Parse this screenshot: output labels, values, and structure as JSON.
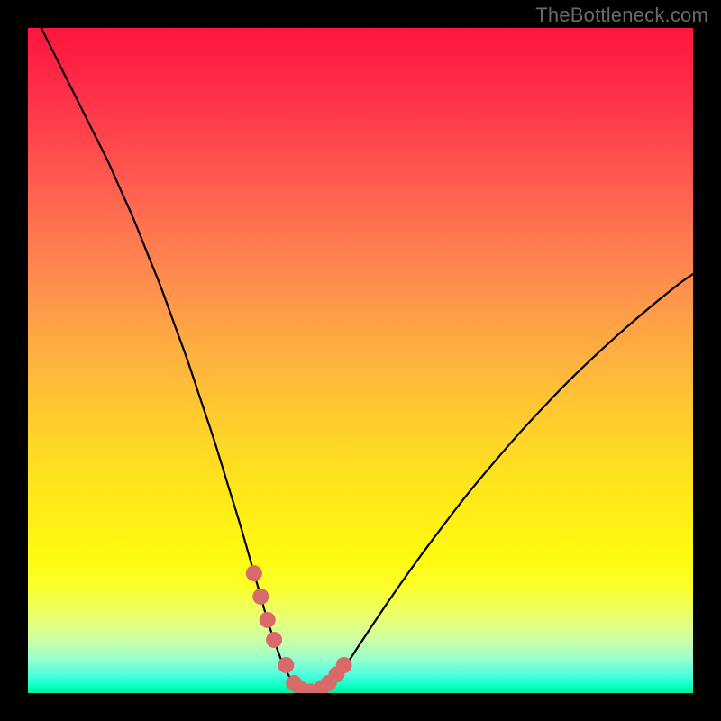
{
  "watermark": {
    "text": "TheBottleneck.com"
  },
  "colors": {
    "page_bg": "#000000",
    "curve": "#000000",
    "marker_fill": "#d86a6a",
    "marker_stroke": "#d86a6a",
    "gradient_top": "#ff163e",
    "gradient_bottom": "#02f09a"
  },
  "chart_data": {
    "type": "line",
    "title": "",
    "xlabel": "",
    "ylabel": "",
    "xlim": [
      0,
      100
    ],
    "ylim": [
      0,
      100
    ],
    "grid": false,
    "legend": false,
    "series": [
      {
        "name": "bottleneck-curve",
        "x": [
          2,
          4,
          6,
          8,
          10,
          12,
          14,
          16,
          18,
          20,
          22,
          24,
          26,
          28,
          30,
          32,
          34,
          35,
          36,
          37,
          38,
          39,
          40,
          41,
          42,
          43,
          44,
          46,
          48,
          50,
          54,
          58,
          62,
          66,
          70,
          74,
          78,
          82,
          86,
          90,
          94,
          98,
          100
        ],
        "values": [
          100,
          96,
          92,
          88,
          84,
          80,
          75.5,
          71,
          66,
          61,
          55.5,
          50,
          44,
          38,
          31.5,
          25,
          18,
          14.5,
          11,
          8,
          5.2,
          3,
          1.5,
          0.6,
          0.2,
          0.2,
          0.6,
          2,
          4.5,
          7.5,
          13.5,
          19.2,
          24.6,
          29.8,
          34.6,
          39.2,
          43.5,
          47.6,
          51.4,
          55,
          58.4,
          61.6,
          63
        ]
      }
    ],
    "markers": {
      "name": "valley-markers",
      "x": [
        34.0,
        35.0,
        36.0,
        37.0,
        38.8,
        40.0,
        41.2,
        42.5,
        44.0,
        45.2,
        46.4,
        47.5
      ],
      "values": [
        18.0,
        14.5,
        11.0,
        8.0,
        4.2,
        1.5,
        0.5,
        0.2,
        0.6,
        1.5,
        2.8,
        4.2
      ],
      "radius": 9
    }
  }
}
